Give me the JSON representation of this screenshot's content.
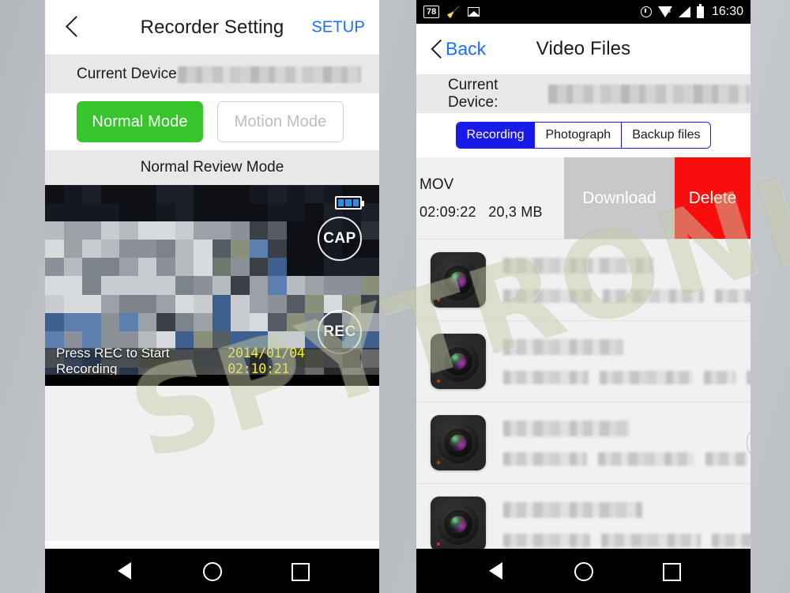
{
  "watermark": {
    "text": "SPYTRONIC"
  },
  "left_phone": {
    "nav": {
      "back_icon": "chevron-left-icon",
      "title": "Recorder Setting",
      "action_label": "SETUP"
    },
    "device": {
      "label": "Current Device",
      "value_redacted": ""
    },
    "modes": [
      {
        "label": "Normal Mode",
        "state": "active"
      },
      {
        "label": "Motion Mode",
        "state": "inactive"
      }
    ],
    "review_mode_label": "Normal Review Mode",
    "preview": {
      "battery_icon": "battery-icon",
      "cap_button": "CAP",
      "rec_button": "REC",
      "caption": "Press REC to Start Recording",
      "timestamp": "2014/01/04 02:10:21"
    },
    "sysnav": {
      "back": "triangle-back-icon",
      "home": "circle-home-icon",
      "recents": "square-recents-icon"
    }
  },
  "right_phone": {
    "statusbar": {
      "badge": "78",
      "broom_icon": "broom-icon",
      "picture_icon": "picture-icon",
      "alarm_icon": "alarm-icon",
      "wifi_icon": "wifi-warning-icon",
      "signal_icon": "signal-icon",
      "battery_icon": "battery-icon",
      "clock": "16:30"
    },
    "nav": {
      "back_icon": "chevron-left-icon",
      "back_label": "Back",
      "title": "Video Files"
    },
    "device": {
      "label": "Current Device:",
      "value_redacted": ""
    },
    "tabs": [
      {
        "label": "Recording",
        "selected": true
      },
      {
        "label": "Photograph",
        "selected": false
      },
      {
        "label": "Backup files",
        "selected": false
      }
    ],
    "swiped_row": {
      "filename": "MOV",
      "duration": "02:09:22",
      "size": "20,3 MB",
      "lock_icon": "lock-closed-icon",
      "download_label": "Download",
      "delete_label": "Delete"
    },
    "file_rows": [
      {
        "thumb_icon": "camera-lens-icon",
        "lock_icon": "lock-open-icon",
        "title_redacted": "",
        "meta_redacted": ""
      },
      {
        "thumb_icon": "camera-lens-icon",
        "lock_icon": "lock-open-icon",
        "title_redacted": "",
        "meta_redacted": ""
      },
      {
        "thumb_icon": "camera-lens-icon",
        "lock_icon": "lock-open-icon",
        "title_redacted": "",
        "meta_redacted": ""
      },
      {
        "thumb_icon": "camera-lens-icon",
        "lock_icon": "lock-open-icon",
        "title_redacted": "",
        "meta_redacted": ""
      }
    ],
    "sysnav": {
      "back": "triangle-back-icon",
      "home": "circle-home-icon",
      "recents": "square-recents-icon"
    }
  },
  "colors": {
    "accent_blue": "#1a6dff",
    "segment_blue": "#1a1ae8",
    "active_green": "#36c62b",
    "delete_red": "#fa0d0d",
    "timestamp_yellow": "#f2ef2a",
    "page_background": "#b9bdc2"
  }
}
